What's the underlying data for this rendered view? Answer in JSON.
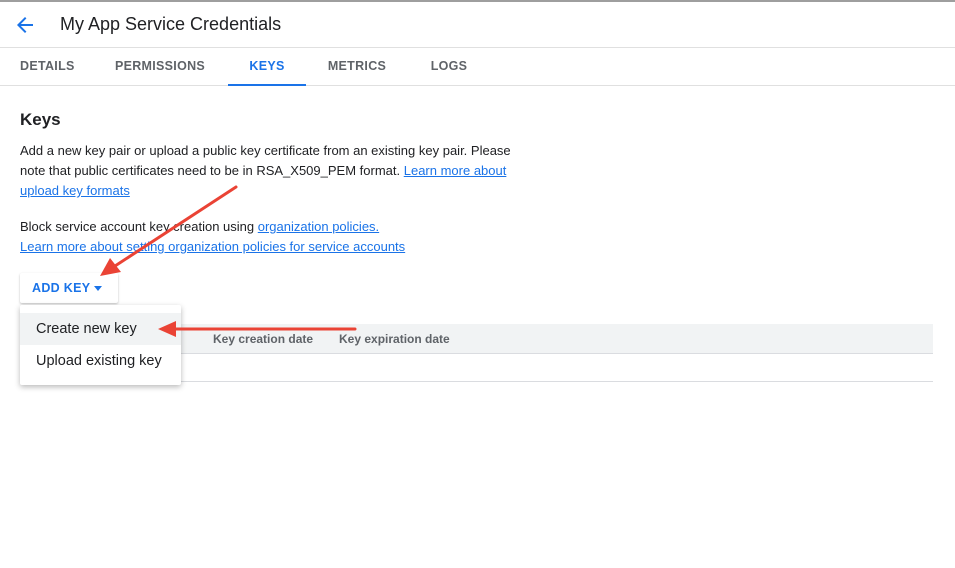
{
  "header": {
    "title": "My App Service Credentials",
    "back_icon": "arrow-back-icon"
  },
  "tabs": [
    {
      "label": "DETAILS",
      "active": false
    },
    {
      "label": "PERMISSIONS",
      "active": false
    },
    {
      "label": "KEYS",
      "active": true
    },
    {
      "label": "METRICS",
      "active": false
    },
    {
      "label": "LOGS",
      "active": false
    }
  ],
  "keys_section": {
    "title": "Keys",
    "description": "Add a new key pair or upload a public key certificate from an existing key pair. Please note that public certificates need to be in RSA_X509_PEM format.",
    "description_link": "Learn more about upload key formats",
    "block_text": "Block service account key creation using",
    "org_policies_link": "organization policies.",
    "learn_more_link": "Learn more about setting organization policies for service accounts"
  },
  "add_key": {
    "label": "ADD KEY",
    "menu": [
      "Create new key",
      "Upload existing key"
    ]
  },
  "table": {
    "columns": [
      "Key creation date",
      "Key expiration date"
    ]
  },
  "colors": {
    "accent": "#1a73e8",
    "annotation_arrow": "#ea4335"
  }
}
